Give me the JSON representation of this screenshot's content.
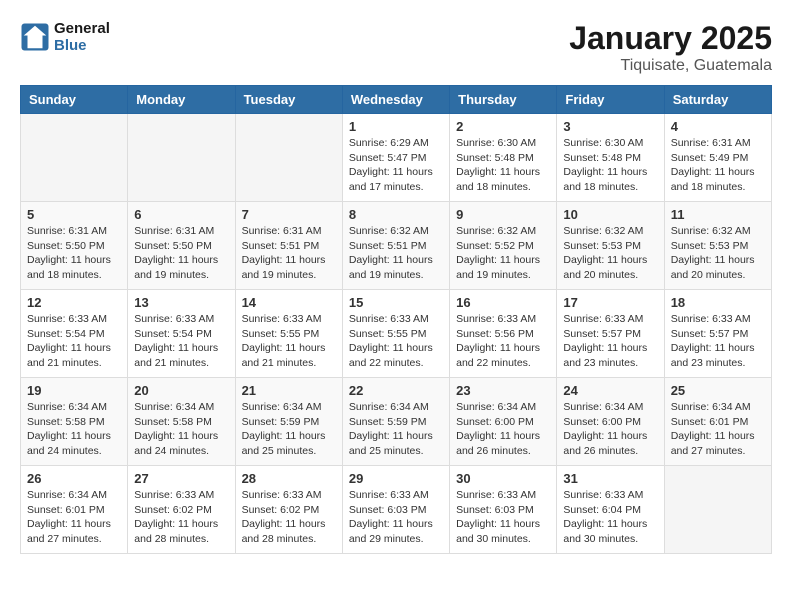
{
  "header": {
    "logo_line1": "General",
    "logo_line2": "Blue",
    "month": "January 2025",
    "location": "Tiquisate, Guatemala"
  },
  "days_of_week": [
    "Sunday",
    "Monday",
    "Tuesday",
    "Wednesday",
    "Thursday",
    "Friday",
    "Saturday"
  ],
  "weeks": [
    [
      {
        "day": "",
        "info": ""
      },
      {
        "day": "",
        "info": ""
      },
      {
        "day": "",
        "info": ""
      },
      {
        "day": "1",
        "info": "Sunrise: 6:29 AM\nSunset: 5:47 PM\nDaylight: 11 hours\nand 17 minutes."
      },
      {
        "day": "2",
        "info": "Sunrise: 6:30 AM\nSunset: 5:48 PM\nDaylight: 11 hours\nand 18 minutes."
      },
      {
        "day": "3",
        "info": "Sunrise: 6:30 AM\nSunset: 5:48 PM\nDaylight: 11 hours\nand 18 minutes."
      },
      {
        "day": "4",
        "info": "Sunrise: 6:31 AM\nSunset: 5:49 PM\nDaylight: 11 hours\nand 18 minutes."
      }
    ],
    [
      {
        "day": "5",
        "info": "Sunrise: 6:31 AM\nSunset: 5:50 PM\nDaylight: 11 hours\nand 18 minutes."
      },
      {
        "day": "6",
        "info": "Sunrise: 6:31 AM\nSunset: 5:50 PM\nDaylight: 11 hours\nand 19 minutes."
      },
      {
        "day": "7",
        "info": "Sunrise: 6:31 AM\nSunset: 5:51 PM\nDaylight: 11 hours\nand 19 minutes."
      },
      {
        "day": "8",
        "info": "Sunrise: 6:32 AM\nSunset: 5:51 PM\nDaylight: 11 hours\nand 19 minutes."
      },
      {
        "day": "9",
        "info": "Sunrise: 6:32 AM\nSunset: 5:52 PM\nDaylight: 11 hours\nand 19 minutes."
      },
      {
        "day": "10",
        "info": "Sunrise: 6:32 AM\nSunset: 5:53 PM\nDaylight: 11 hours\nand 20 minutes."
      },
      {
        "day": "11",
        "info": "Sunrise: 6:32 AM\nSunset: 5:53 PM\nDaylight: 11 hours\nand 20 minutes."
      }
    ],
    [
      {
        "day": "12",
        "info": "Sunrise: 6:33 AM\nSunset: 5:54 PM\nDaylight: 11 hours\nand 21 minutes."
      },
      {
        "day": "13",
        "info": "Sunrise: 6:33 AM\nSunset: 5:54 PM\nDaylight: 11 hours\nand 21 minutes."
      },
      {
        "day": "14",
        "info": "Sunrise: 6:33 AM\nSunset: 5:55 PM\nDaylight: 11 hours\nand 21 minutes."
      },
      {
        "day": "15",
        "info": "Sunrise: 6:33 AM\nSunset: 5:55 PM\nDaylight: 11 hours\nand 22 minutes."
      },
      {
        "day": "16",
        "info": "Sunrise: 6:33 AM\nSunset: 5:56 PM\nDaylight: 11 hours\nand 22 minutes."
      },
      {
        "day": "17",
        "info": "Sunrise: 6:33 AM\nSunset: 5:57 PM\nDaylight: 11 hours\nand 23 minutes."
      },
      {
        "day": "18",
        "info": "Sunrise: 6:33 AM\nSunset: 5:57 PM\nDaylight: 11 hours\nand 23 minutes."
      }
    ],
    [
      {
        "day": "19",
        "info": "Sunrise: 6:34 AM\nSunset: 5:58 PM\nDaylight: 11 hours\nand 24 minutes."
      },
      {
        "day": "20",
        "info": "Sunrise: 6:34 AM\nSunset: 5:58 PM\nDaylight: 11 hours\nand 24 minutes."
      },
      {
        "day": "21",
        "info": "Sunrise: 6:34 AM\nSunset: 5:59 PM\nDaylight: 11 hours\nand 25 minutes."
      },
      {
        "day": "22",
        "info": "Sunrise: 6:34 AM\nSunset: 5:59 PM\nDaylight: 11 hours\nand 25 minutes."
      },
      {
        "day": "23",
        "info": "Sunrise: 6:34 AM\nSunset: 6:00 PM\nDaylight: 11 hours\nand 26 minutes."
      },
      {
        "day": "24",
        "info": "Sunrise: 6:34 AM\nSunset: 6:00 PM\nDaylight: 11 hours\nand 26 minutes."
      },
      {
        "day": "25",
        "info": "Sunrise: 6:34 AM\nSunset: 6:01 PM\nDaylight: 11 hours\nand 27 minutes."
      }
    ],
    [
      {
        "day": "26",
        "info": "Sunrise: 6:34 AM\nSunset: 6:01 PM\nDaylight: 11 hours\nand 27 minutes."
      },
      {
        "day": "27",
        "info": "Sunrise: 6:33 AM\nSunset: 6:02 PM\nDaylight: 11 hours\nand 28 minutes."
      },
      {
        "day": "28",
        "info": "Sunrise: 6:33 AM\nSunset: 6:02 PM\nDaylight: 11 hours\nand 28 minutes."
      },
      {
        "day": "29",
        "info": "Sunrise: 6:33 AM\nSunset: 6:03 PM\nDaylight: 11 hours\nand 29 minutes."
      },
      {
        "day": "30",
        "info": "Sunrise: 6:33 AM\nSunset: 6:03 PM\nDaylight: 11 hours\nand 30 minutes."
      },
      {
        "day": "31",
        "info": "Sunrise: 6:33 AM\nSunset: 6:04 PM\nDaylight: 11 hours\nand 30 minutes."
      },
      {
        "day": "",
        "info": ""
      }
    ]
  ]
}
